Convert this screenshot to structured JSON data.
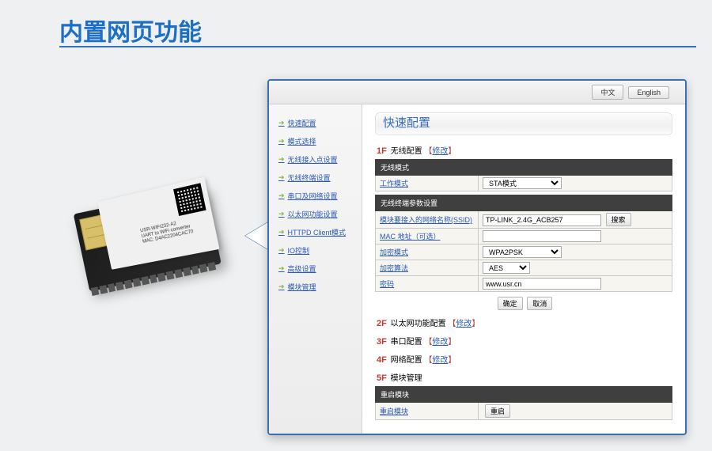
{
  "page": {
    "title": "内置网页功能"
  },
  "device": {
    "model": "USR-WIFI232-A2",
    "subtitle": "UART to WiFi converter",
    "mac": "MAC: D4AC2204CAC70"
  },
  "langs": {
    "zh": "中文",
    "en": "English"
  },
  "sidebar": {
    "items": [
      {
        "label": "快速配置"
      },
      {
        "label": "模式选择"
      },
      {
        "label": "无线接入点设置"
      },
      {
        "label": "无线终端设置"
      },
      {
        "label": "串口及网络设置"
      },
      {
        "label": "以太网功能设置"
      },
      {
        "label": "HTTPD Client模式"
      },
      {
        "label": "IO控制"
      },
      {
        "label": "高级设置"
      },
      {
        "label": "模块管理"
      }
    ]
  },
  "content": {
    "title": "快速配置",
    "step1": {
      "num": "1F",
      "text": "无线配置",
      "link": "修改"
    },
    "table1": {
      "header": "无线模式",
      "row1_label": "工作模式",
      "row1_value": "STA模式"
    },
    "table2": {
      "header": "无线终端参数设置",
      "ssid_label": "模块要接入的网络名称(SSID)",
      "ssid_value": "TP-LINK_2.4G_ACB257",
      "search_btn": "搜索",
      "mac_label": "MAC 地址（可选）",
      "mac_value": "",
      "enc_mode_label": "加密模式",
      "enc_mode_value": "WPA2PSK",
      "enc_algo_label": "加密算法",
      "enc_algo_value": "AES",
      "pwd_label": "密码",
      "pwd_value": "www.usr.cn"
    },
    "buttons": {
      "confirm": "确定",
      "cancel": "取消"
    },
    "step2": {
      "num": "2F",
      "text": "以太网功能配置",
      "link": "修改"
    },
    "step3": {
      "num": "3F",
      "text": "串口配置",
      "link": "修改"
    },
    "step4": {
      "num": "4F",
      "text": "网络配置",
      "link": "修改"
    },
    "step5": {
      "num": "5F",
      "text": "模块管理"
    },
    "reboot": {
      "header": "重启模块",
      "label": "重启模块",
      "btn": "重启"
    }
  }
}
